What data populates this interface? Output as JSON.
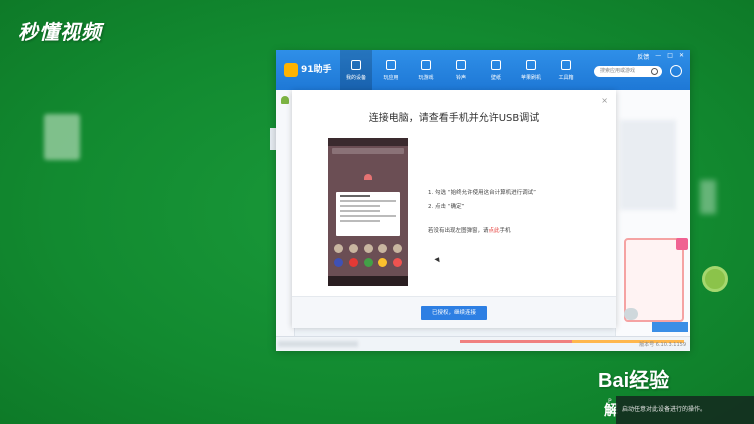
{
  "watermark": {
    "brand": "秒懂视频",
    "bottom_brand": "Bai经验",
    "bottom_sub": "解",
    "tooltip": "启动任意对此设备进行的操作。",
    "tooltip_prefix": "P"
  },
  "app": {
    "name": "91助手",
    "nav": [
      {
        "label": "我的设备",
        "icon": "phone-icon"
      },
      {
        "label": "玩应用",
        "icon": "bag-icon"
      },
      {
        "label": "玩游戏",
        "icon": "gamepad-icon"
      },
      {
        "label": "铃声",
        "icon": "music-icon"
      },
      {
        "label": "壁纸",
        "icon": "image-icon"
      },
      {
        "label": "苹果刷机",
        "icon": "refresh-icon"
      },
      {
        "label": "工具箱",
        "icon": "toolbox-icon"
      }
    ],
    "window_controls": {
      "feedback": "反馈",
      "min": "—",
      "max": "□",
      "close": "✕"
    },
    "search_placeholder": "搜索应用或游戏",
    "version": "版本号 6.10.3.1159"
  },
  "dialog": {
    "title": "连接电脑，请查看手机并允许USB调试",
    "close": "×",
    "step1": "1. 勾选 “始终允许使用这台计算机进行调试”",
    "step2": "2. 点击 “确定”",
    "tip_prefix": "若没有出现左图弹窗，请",
    "tip_link": "点此",
    "tip_suffix": "手机",
    "button": "已授权，继续连接"
  },
  "colors": {
    "titlebar": "#1e78d6",
    "button": "#2d7fe3",
    "desktop": "#128a30"
  }
}
